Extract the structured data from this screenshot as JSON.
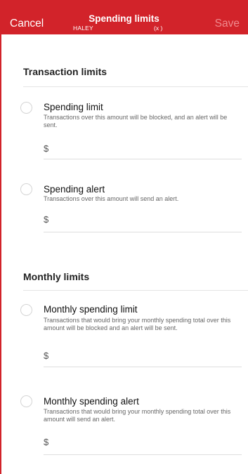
{
  "header": {
    "cancel_label": "Cancel",
    "title": "Spending limits",
    "subtitle_name": "HALEY",
    "subtitle_suffix": "(x     )",
    "save_label": "Save"
  },
  "sections": [
    {
      "title": "Transaction limits",
      "items": [
        {
          "title": "Spending limit",
          "description": "Transactions over this amount will be blocked, and an alert will be sent.",
          "currency_symbol": "$",
          "value": ""
        },
        {
          "title": "Spending alert",
          "description": "Transactions over this amount will send an alert.",
          "currency_symbol": "$",
          "value": ""
        }
      ]
    },
    {
      "title": "Monthly limits",
      "items": [
        {
          "title": "Monthly spending limit",
          "description": "Transactions that would bring your monthly spending total over this amount will be blocked and an alert will be sent.",
          "currency_symbol": "$",
          "value": ""
        },
        {
          "title": "Monthly spending alert",
          "description": "Transactions that would bring your monthly spending total over this amount will send an alert.",
          "currency_symbol": "$",
          "value": ""
        }
      ]
    }
  ],
  "colors": {
    "header_background": "#d2232a",
    "save_disabled": "#f08a8e"
  }
}
